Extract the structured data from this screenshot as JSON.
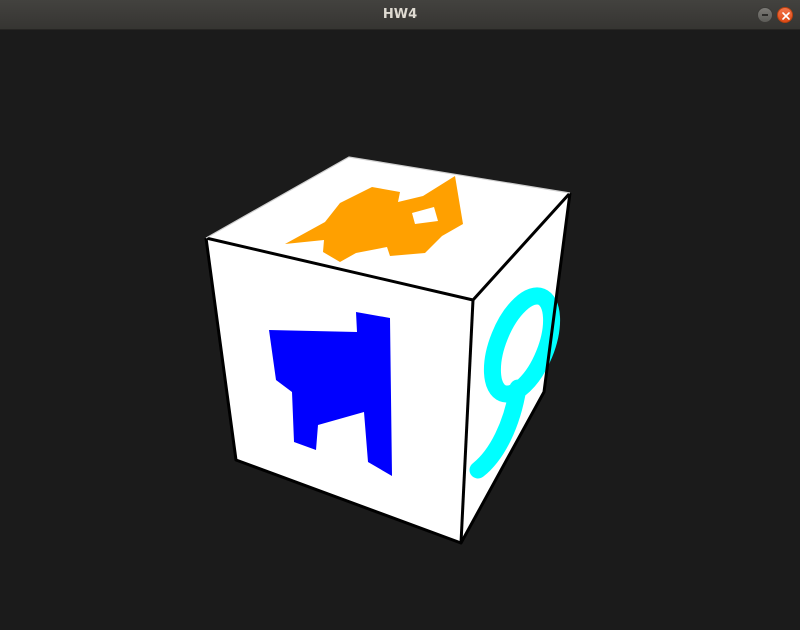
{
  "window": {
    "title": "HW4"
  },
  "titlebar_buttons": {
    "minimize_icon": "minimize-icon",
    "close_icon": "close-icon"
  },
  "scene": {
    "background_color": "#1b1b1b",
    "cube": {
      "face_color": "#ffffff",
      "edge_color": "#000000",
      "front_shape_color": "#0000ff",
      "top_shape_color": "#ffa000",
      "right_shape_color": "#00ffff"
    }
  }
}
